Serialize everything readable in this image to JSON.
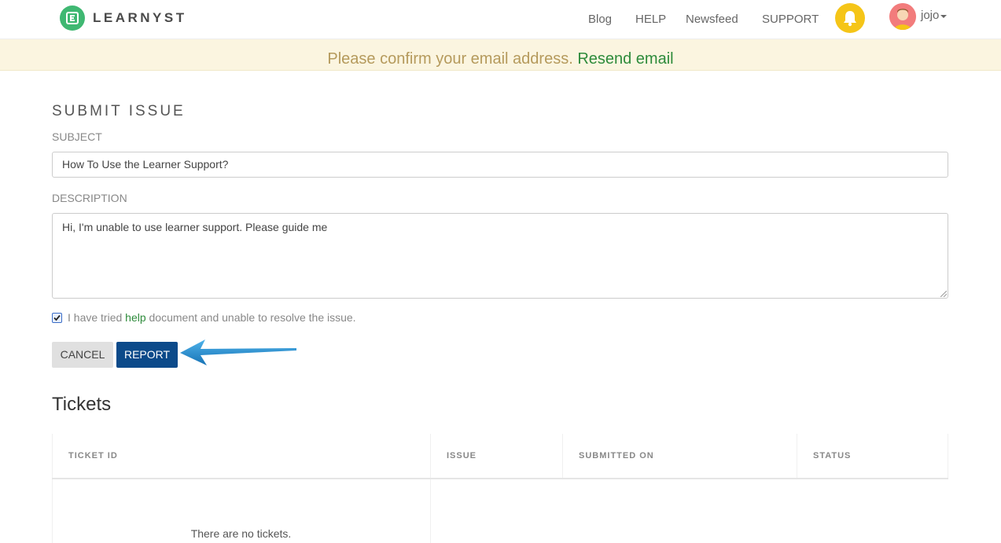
{
  "header": {
    "brand": "LEARNYST",
    "nav": [
      "Blog",
      "HELP",
      "Newsfeed",
      "SUPPORT"
    ],
    "username": "jojo",
    "bell_icon": "bell-icon",
    "avatar_icon": "user-avatar-icon"
  },
  "banner": {
    "message": "Please confirm your email address.",
    "link": "Resend email"
  },
  "form": {
    "title": "SUBMIT ISSUE",
    "subject_label": "SUBJECT",
    "subject_value": "How To Use the Learner Support?",
    "description_label": "DESCRIPTION",
    "description_value": "Hi, I'm unable to use learner support. Please guide me",
    "checkbox_checked": true,
    "checkbox_text_before": "I have tried",
    "checkbox_link": "help",
    "checkbox_text_after": "document and unable to resolve the issue.",
    "cancel_label": "CANCEL",
    "report_label": "REPORT"
  },
  "tickets": {
    "title": "Tickets",
    "columns": [
      "TICKET ID",
      "ISSUE",
      "SUBMITTED ON",
      "STATUS"
    ],
    "empty_message": "There are no tickets."
  },
  "colors": {
    "brand_green": "#3fb872",
    "report_blue": "#0c4a8a",
    "link_green": "#2e8b3b",
    "bell_yellow": "#f5c518",
    "annotation_arrow": "#1b86c9"
  }
}
